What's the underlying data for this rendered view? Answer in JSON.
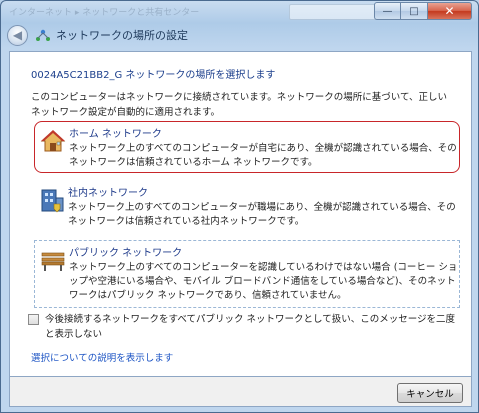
{
  "background_window": {
    "title": "インターネット ▸ ネットワークと共有センター"
  },
  "titlebar": {
    "minimize": "—",
    "maximize": "□",
    "close": "✕"
  },
  "nav": {
    "back": "◀",
    "title": "ネットワークの場所の設定"
  },
  "main": {
    "subtitle": "0024A5C21BB2_G ネットワークの場所を選択します",
    "description": "このコンピューターはネットワークに接続されています。ネットワークの場所に基づいて、正しいネットワーク設定が自動的に適用されます。"
  },
  "options": [
    {
      "title": "ホーム ネットワーク",
      "desc": "ネットワーク上のすべてのコンピューターが自宅にあり、全機が認識されている場合、そのネットワークは信頼されているホーム ネットワークです。",
      "icon": "house-icon"
    },
    {
      "title": "社内ネットワーク",
      "desc": "ネットワーク上のすべてのコンピューターが職場にあり、全機が認識されている場合、そのネットワークは信頼されている社内ネットワークです。",
      "icon": "office-building-icon"
    },
    {
      "title": "パブリック ネットワーク",
      "desc": "ネットワーク上のすべてのコンピューターを認識しているわけではない場合 (コーヒー ショップや空港にいる場合や、モバイル ブロードバンド通信をしている場合など)、そのネットワークはパブリック ネットワークであり、信頼されていません。",
      "icon": "park-bench-icon"
    }
  ],
  "checkbox": {
    "label": "今後接続するネットワークをすべてパブリック ネットワークとして扱い、このメッセージを二度と表示しない",
    "checked": false
  },
  "help_link": "選択についての説明を表示します",
  "footer": {
    "cancel": "キャンセル"
  },
  "colors": {
    "link": "#1c54c4",
    "selection_border": "#c8262a",
    "accent_title": "#1e3a8a"
  }
}
